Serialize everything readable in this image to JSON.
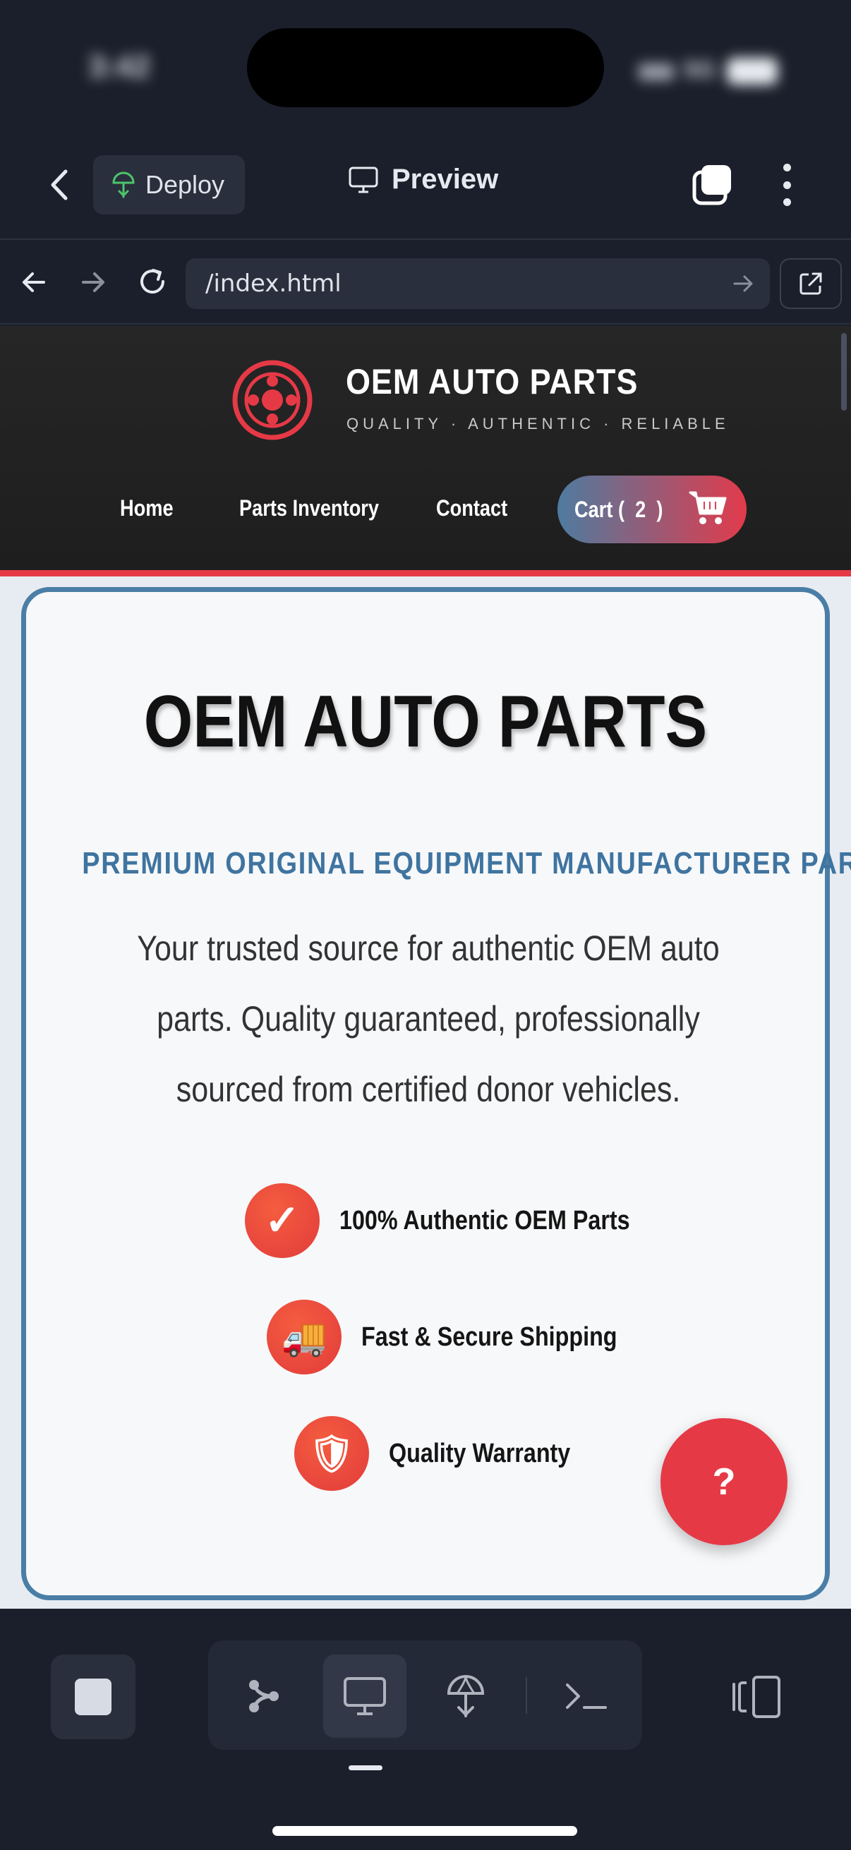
{
  "status_bar": {
    "time": "3:42",
    "network": "5G"
  },
  "app_header": {
    "deploy_label": "Deploy",
    "preview_label": "Preview"
  },
  "url_bar": {
    "url": "/index.html"
  },
  "site": {
    "brand_name": "OEM AUTO PARTS",
    "brand_tagline": "QUALITY · AUTHENTIC · RELIABLE",
    "nav": [
      {
        "label": "Home"
      },
      {
        "label": "Parts Inventory"
      },
      {
        "label": "Contact"
      }
    ],
    "cart_label": "Cart (",
    "cart_count": "2",
    "cart_close": ")",
    "colors": {
      "accent_red": "#e63946",
      "accent_blue": "#4a7ea6",
      "header_bg": "#222222"
    }
  },
  "hero": {
    "title": "OEM AUTO PARTS",
    "subtitle": "PREMIUM ORIGINAL EQUIPMENT MANUFACTURER PARTS",
    "description": "Your trusted source for authentic OEM auto parts. Quality guaranteed, professionally sourced from certified donor vehicles.",
    "features": [
      {
        "icon": "checkmark-icon",
        "glyph": "✓",
        "label": "100% Authentic OEM Parts"
      },
      {
        "icon": "truck-icon",
        "glyph": "🚚",
        "label": "Fast & Secure Shipping"
      },
      {
        "icon": "shield-icon",
        "glyph": "🛡",
        "label": "Quality Warranty"
      }
    ],
    "help_label": "?"
  }
}
